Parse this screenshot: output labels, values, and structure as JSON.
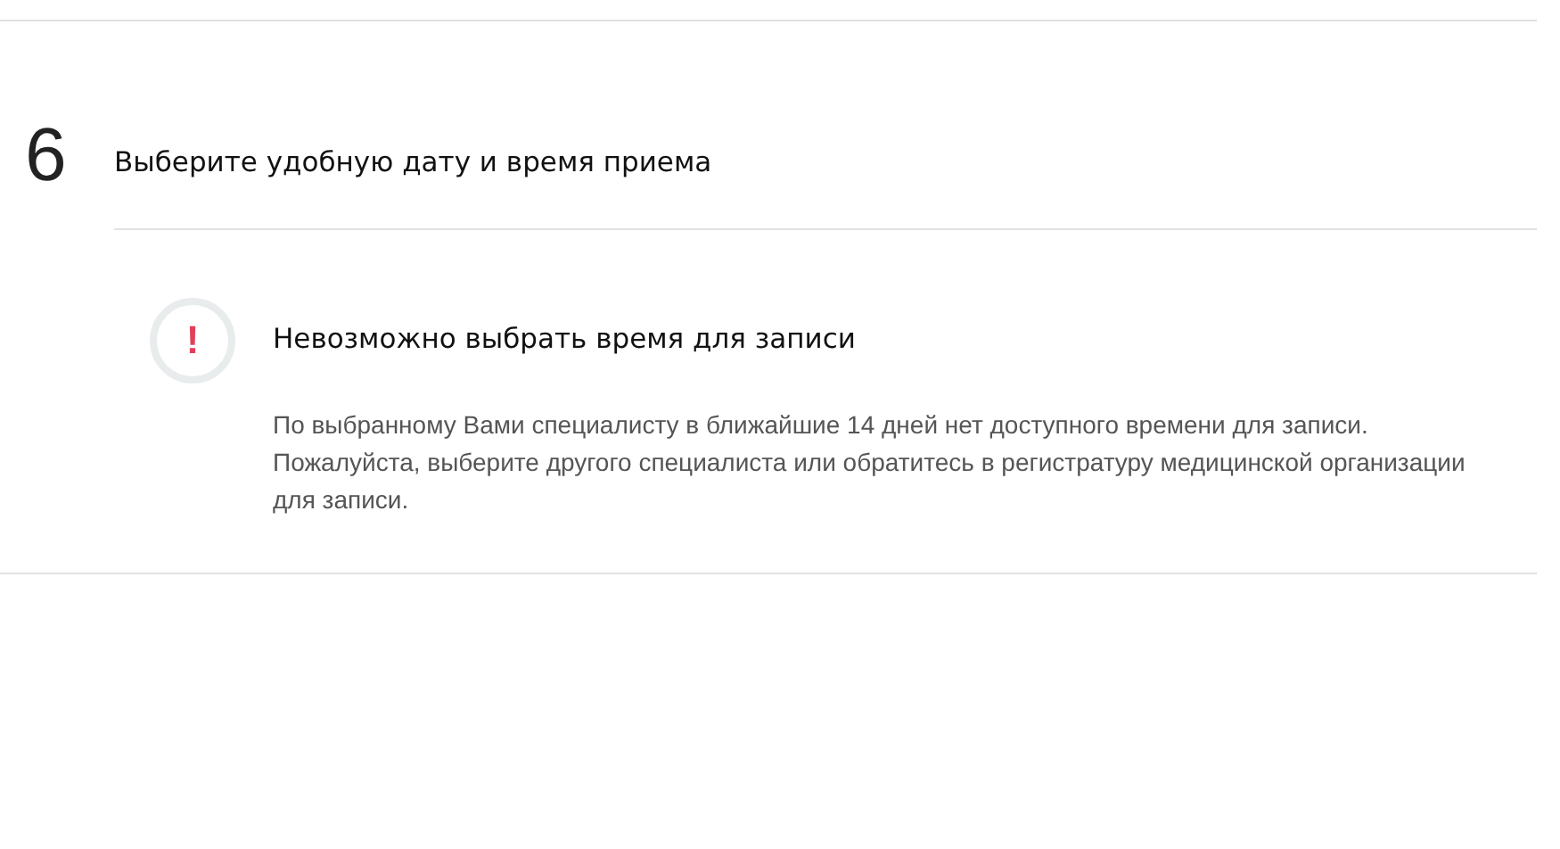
{
  "step": {
    "number": "6",
    "title": "Выберите удобную дату и время приема"
  },
  "alert": {
    "icon": "!",
    "title": "Невозможно выбрать время для записи",
    "message": "По выбранному Вами специалисту в ближайшие 14 дней нет доступного времени для записи. Пожалуйста, выберите другого специалиста или обратитесь в регистратуру медицинской организации для записи."
  }
}
